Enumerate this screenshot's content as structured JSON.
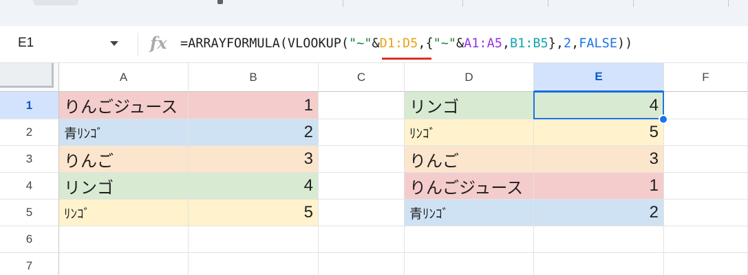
{
  "name_box": {
    "value": "E1"
  },
  "formula_bar": {
    "fx_label": "fx",
    "tokens": [
      {
        "text": "=ARRAYFORMULA(VLOOKUP(",
        "color": "#1f1f1f"
      },
      {
        "text": "\"~\"",
        "color": "#188038"
      },
      {
        "text": "&",
        "color": "#1f1f1f"
      },
      {
        "text": "D1:D5",
        "color": "#e8a317"
      },
      {
        "text": ",{",
        "color": "#1f1f1f"
      },
      {
        "text": "\"~\"",
        "color": "#188038"
      },
      {
        "text": "&",
        "color": "#1f1f1f"
      },
      {
        "text": "A1:A5",
        "color": "#9334e6"
      },
      {
        "text": ",",
        "color": "#1f1f1f"
      },
      {
        "text": "B1:B5",
        "color": "#12a4af"
      },
      {
        "text": "},",
        "color": "#1f1f1f"
      },
      {
        "text": "2",
        "color": "#1a73e8"
      },
      {
        "text": ",",
        "color": "#1f1f1f"
      },
      {
        "text": "FALSE",
        "color": "#1a73e8"
      },
      {
        "text": "))",
        "color": "#1f1f1f"
      }
    ]
  },
  "columns": [
    "A",
    "B",
    "C",
    "D",
    "E",
    "F"
  ],
  "rows": [
    "1",
    "2",
    "3",
    "4",
    "5",
    "6",
    "7"
  ],
  "selected": {
    "column": "E",
    "row": "1"
  },
  "colors": {
    "red": "#f4cccc",
    "blue": "#cfe2f3",
    "orange": "#fce5cd",
    "green": "#d9ead3",
    "yellow": "#fff2cc",
    "selection": "#1a73e8"
  },
  "cells": {
    "A1": "りんごジュース",
    "B1": "1",
    "A2": "青ﾘﾝｺﾞ",
    "B2": "2",
    "A3": "りんご",
    "B3": "3",
    "A4": "リンゴ",
    "B4": "4",
    "A5": "ﾘﾝｺﾞ",
    "B5": "5",
    "D1": "リンゴ",
    "E1": "4",
    "D2": "ﾘﾝｺﾞ",
    "E2": "5",
    "D3": "りんご",
    "E3": "3",
    "D4": "りんごジュース",
    "E4": "1",
    "D5": "青ﾘﾝｺﾞ",
    "E5": "2"
  }
}
